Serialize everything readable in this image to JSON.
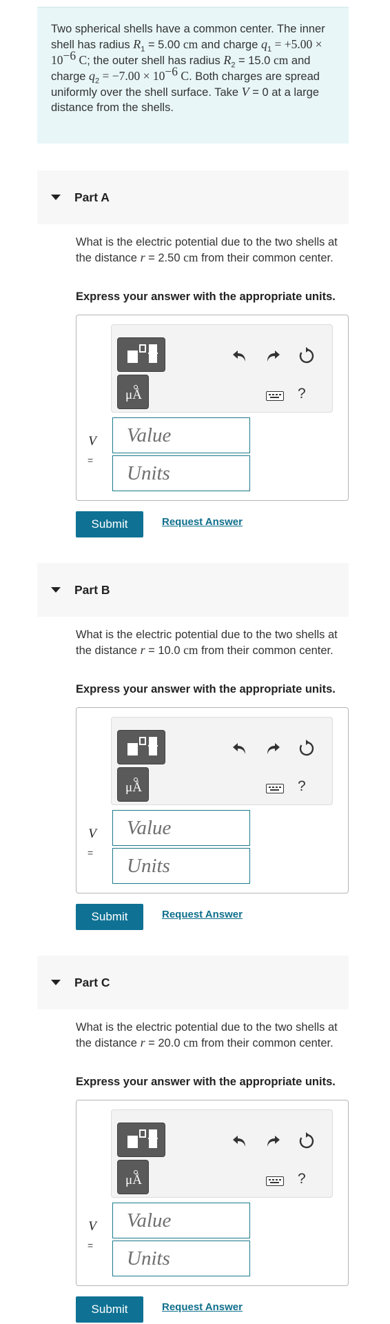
{
  "problem": {
    "t1": "Two spherical shells have a common center. The inner shell has radius ",
    "r1_sym": "R",
    "r1_sub": "1",
    "r1_val": " = 5.00 ",
    "r1_unit": "cm",
    "t2": " and charge ",
    "q1_sym": "q",
    "q1_sub": "1",
    "q1_val": " = +5.00 × 10",
    "q1_exp": "−6",
    "q1_unit": " C",
    "t3": "; the outer shell has radius ",
    "r2_sym": "R",
    "r2_sub": "2",
    "r2_val": " = 15.0 ",
    "r2_unit": "cm",
    "t4": " and charge ",
    "q2_sym": "q",
    "q2_sub": "2",
    "q2_val": " = −7.00 × 10",
    "q2_exp": "−6",
    "q2_unit": " C",
    "t5": ". Both charges are spread uniformly over the shell surface. Take ",
    "v_sym": "V",
    "t6": " = 0 at a large distance from the shells."
  },
  "parts": [
    {
      "title": "Part A",
      "q_pre": "What is the electric potential due to the two shells at the distance ",
      "r_sym": "r",
      "r_val": " = 2.50 ",
      "r_unit": "cm",
      "q_post": " from their common center.",
      "instruction": "Express your answer with the appropriate units.",
      "var": "V",
      "eq": "=",
      "value_placeholder": "Value",
      "units_placeholder": "Units",
      "units_button": "μÅ",
      "help": "?",
      "submit": "Submit",
      "request": "Request Answer"
    },
    {
      "title": "Part B",
      "q_pre": "What is the electric potential due to the two shells at the distance ",
      "r_sym": "r",
      "r_val": " = 10.0 ",
      "r_unit": "cm",
      "q_post": " from their common center.",
      "instruction": "Express your answer with the appropriate units.",
      "var": "V",
      "eq": "=",
      "value_placeholder": "Value",
      "units_placeholder": "Units",
      "units_button": "μÅ",
      "help": "?",
      "submit": "Submit",
      "request": "Request Answer"
    },
    {
      "title": "Part C",
      "q_pre": "What is the electric potential due to the two shells at the distance ",
      "r_sym": "r",
      "r_val": " = 20.0 ",
      "r_unit": "cm",
      "q_post": " from their common center.",
      "instruction": "Express your answer with the appropriate units.",
      "var": "V",
      "eq": "=",
      "value_placeholder": "Value",
      "units_placeholder": "Units",
      "units_button": "μÅ",
      "help": "?",
      "submit": "Submit",
      "request": "Request Answer"
    }
  ],
  "colors": {
    "problem_bg": "#e8f6f7",
    "header_bg": "#f7f7f7",
    "submit_bg": "#0f7294",
    "link": "#0f6f8c",
    "field_border": "#1a7a8c"
  }
}
